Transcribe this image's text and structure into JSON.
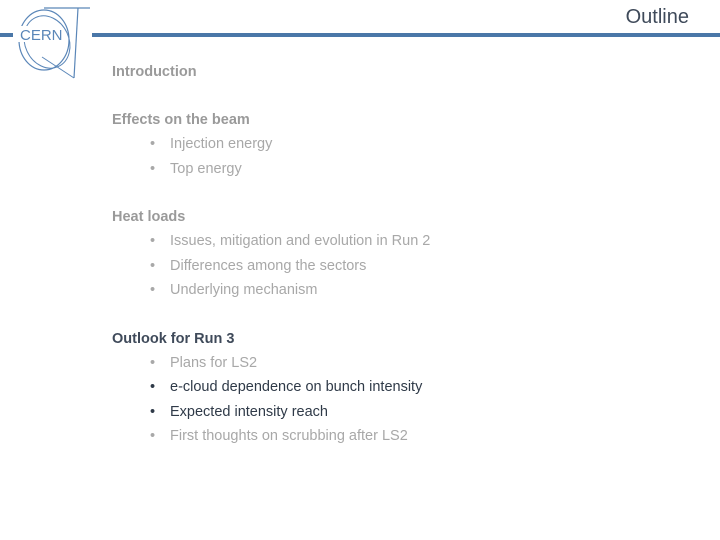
{
  "header": {
    "title": "Outline",
    "logo_text": "CERN",
    "accent_color": "#4a77a8"
  },
  "outline": [
    {
      "heading": "Introduction",
      "active": false,
      "items": []
    },
    {
      "heading": "Effects on the beam",
      "active": false,
      "items": [
        {
          "label": "Injection energy",
          "active": false
        },
        {
          "label": "Top energy",
          "active": false
        }
      ]
    },
    {
      "heading": "Heat loads",
      "active": false,
      "items": [
        {
          "label": "Issues, mitigation and evolution in Run 2",
          "active": false
        },
        {
          "label": "Differences among the sectors",
          "active": false
        },
        {
          "label": "Underlying mechanism",
          "active": false
        }
      ]
    },
    {
      "heading": "Outlook for Run 3",
      "active": true,
      "items": [
        {
          "label": "Plans for LS2",
          "active": false
        },
        {
          "label": "e-cloud dependence on bunch intensity",
          "active": true
        },
        {
          "label": "Expected intensity reach",
          "active": true
        },
        {
          "label": "First thoughts on scrubbing after LS2",
          "active": false
        }
      ]
    }
  ],
  "bullet_char": "•"
}
